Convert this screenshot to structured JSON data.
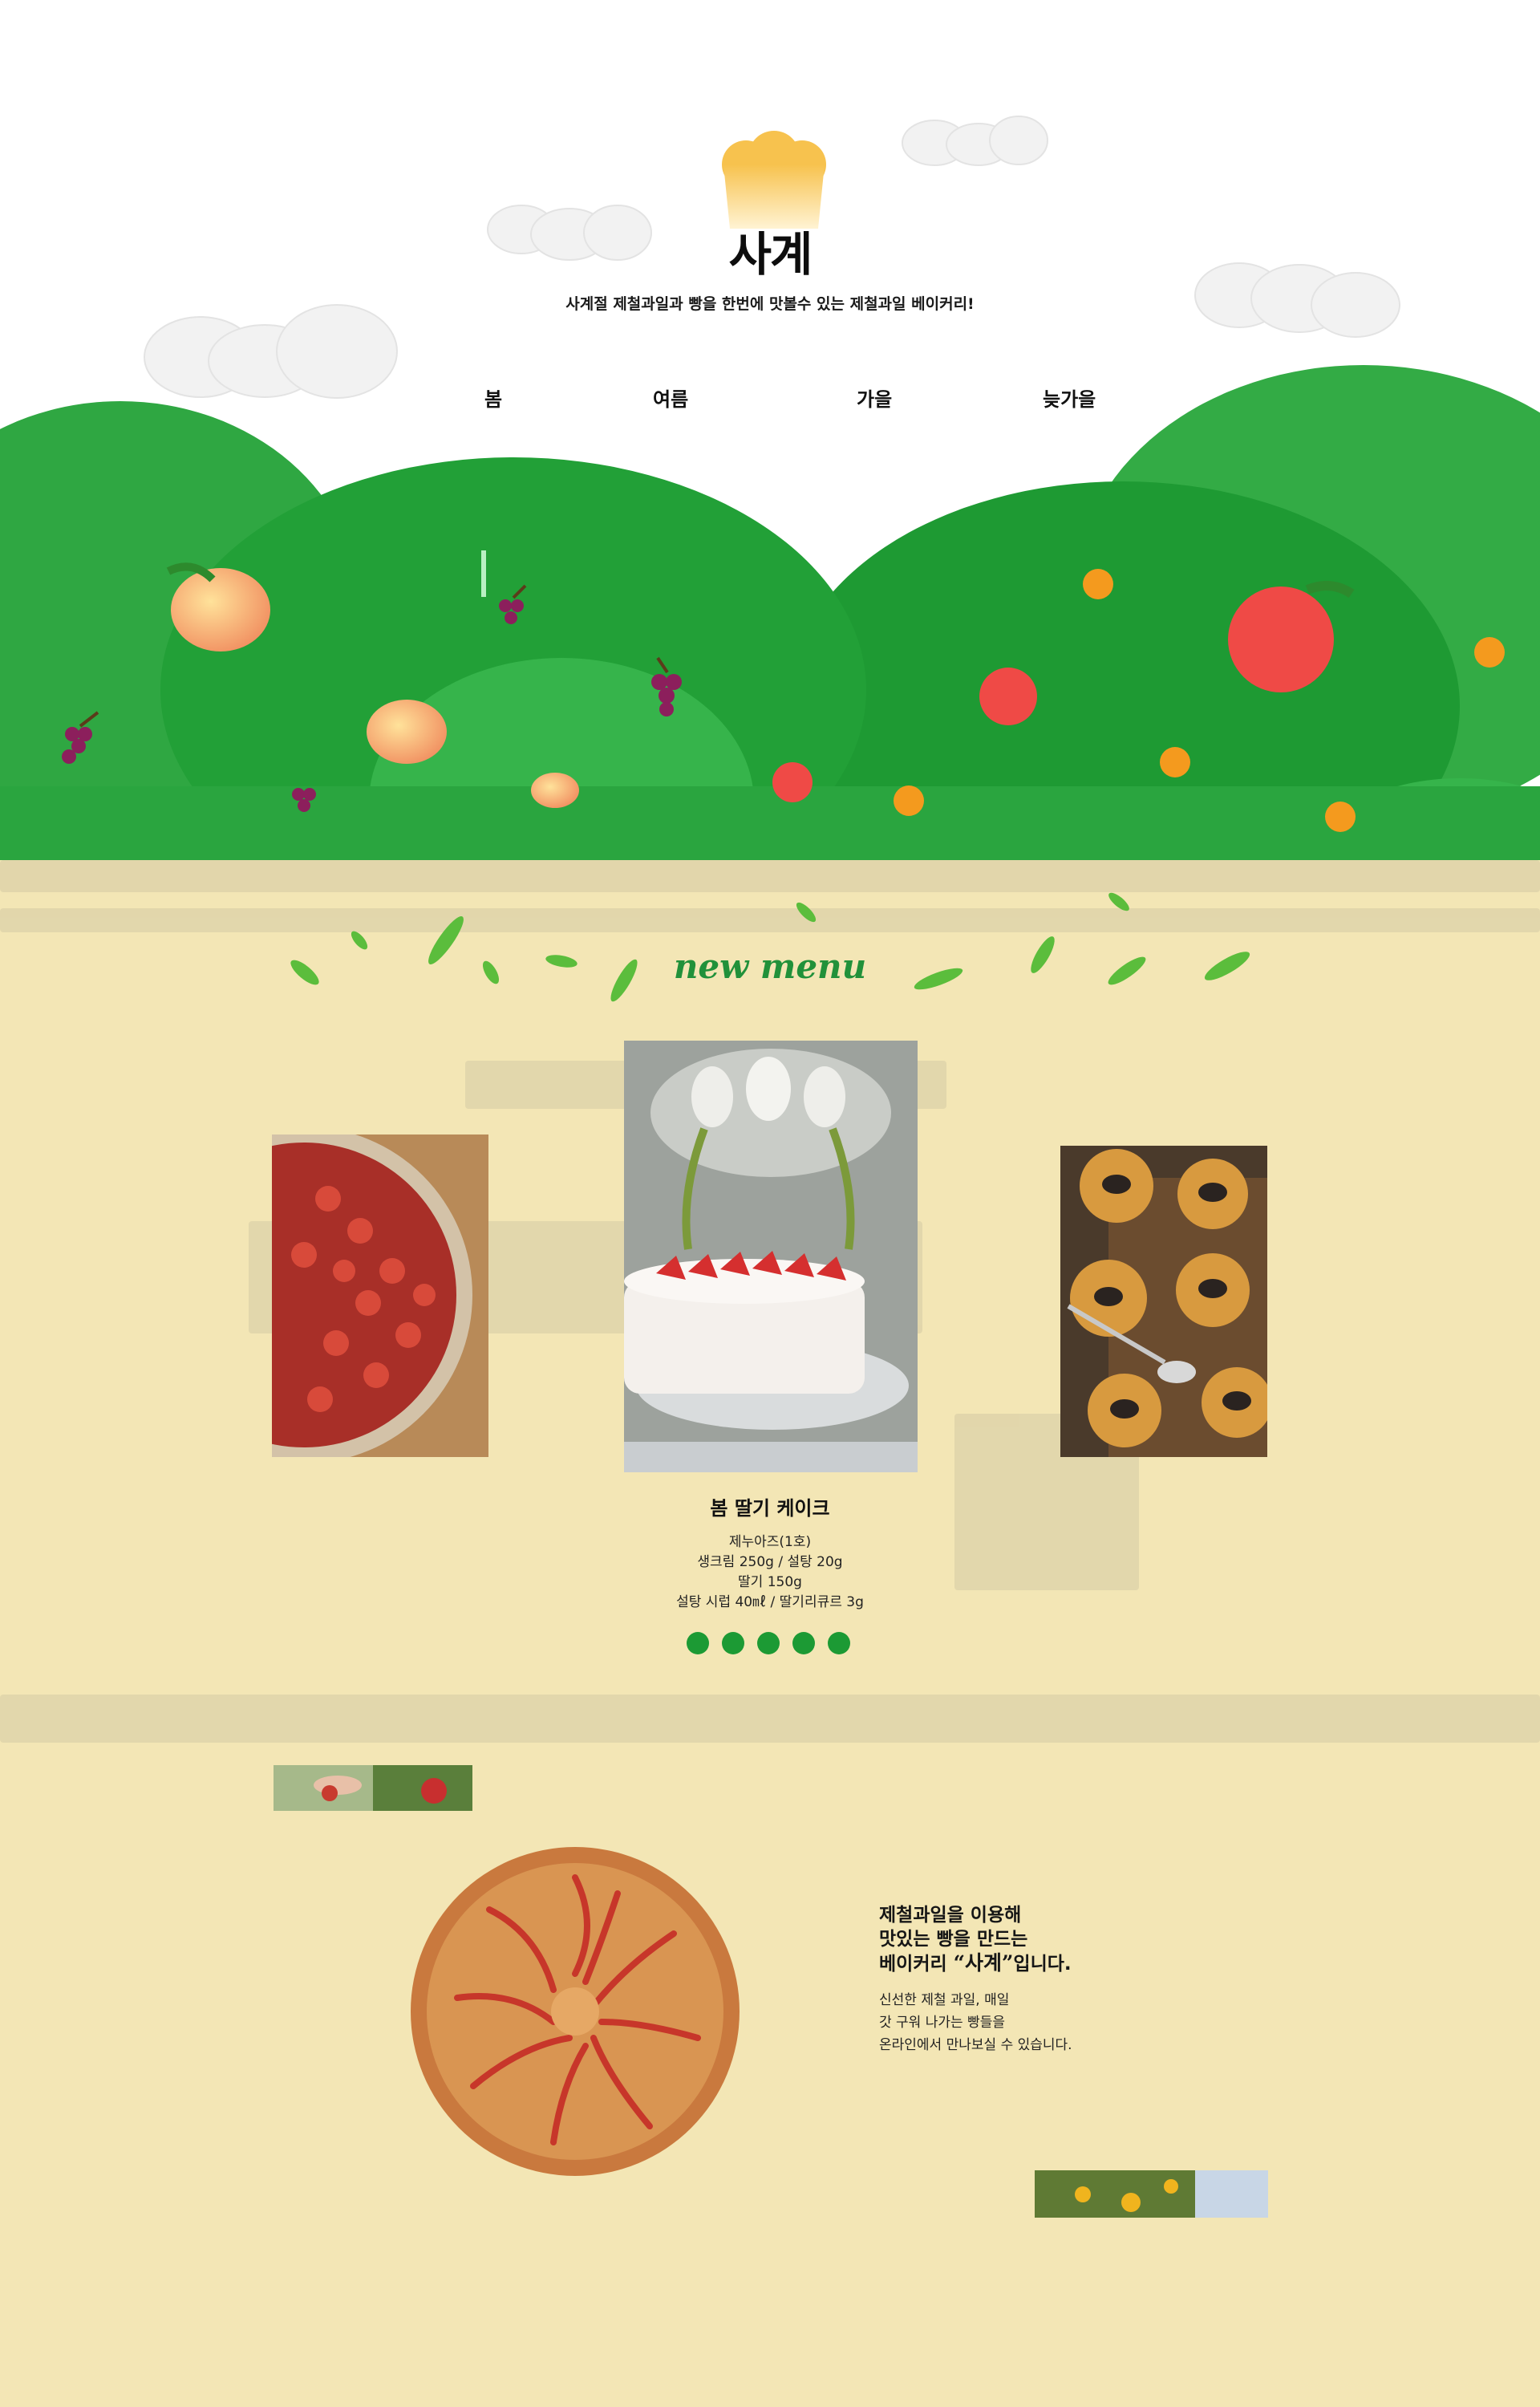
{
  "header": {
    "logo_text": "사계",
    "tagline": "사계절 제철과일과 빵을 한번에 맛볼수 있는 제철과일 베이커리!"
  },
  "nav": {
    "items": [
      {
        "label": "봄"
      },
      {
        "label": "여름"
      },
      {
        "label": "가을"
      },
      {
        "label": "늦가을"
      }
    ]
  },
  "new_menu": {
    "title": "new menu",
    "featured": {
      "name": "봄 딸기 케이크",
      "recipe": [
        "제누아즈(1호)",
        "생크림 250g / 설탕 20g",
        "딸기 150g",
        "설탕 시럽 40㎖ / 딸기리큐르 3g"
      ]
    },
    "slides_count": 5
  },
  "about": {
    "title_line1": "제철과일을 이용해",
    "title_line2": "맛있는 빵을 만드는",
    "title_line3_prefix": "베이커리 ",
    "title_brand": "“사계”",
    "title_line3_suffix": "입니다.",
    "desc_line1": "신선한 제철 과일, 매일",
    "desc_line2": "갓 구워 나가는 빵들을",
    "desc_line3": "온라인에서 만나보실 수 있습니다."
  },
  "colors": {
    "hill_light": "#3cb54a",
    "hill_dark": "#1e9a33",
    "cream_bg": "#f3e6b5",
    "accent_green": "#21913a",
    "dot_green": "#1c9a34",
    "hat_yellow": "#f7c24e"
  },
  "icons": [
    "chef-hat-icon",
    "cloud-icon",
    "apple-icon",
    "peach-icon",
    "grape-icon",
    "orange-icon",
    "leaf-icon"
  ]
}
